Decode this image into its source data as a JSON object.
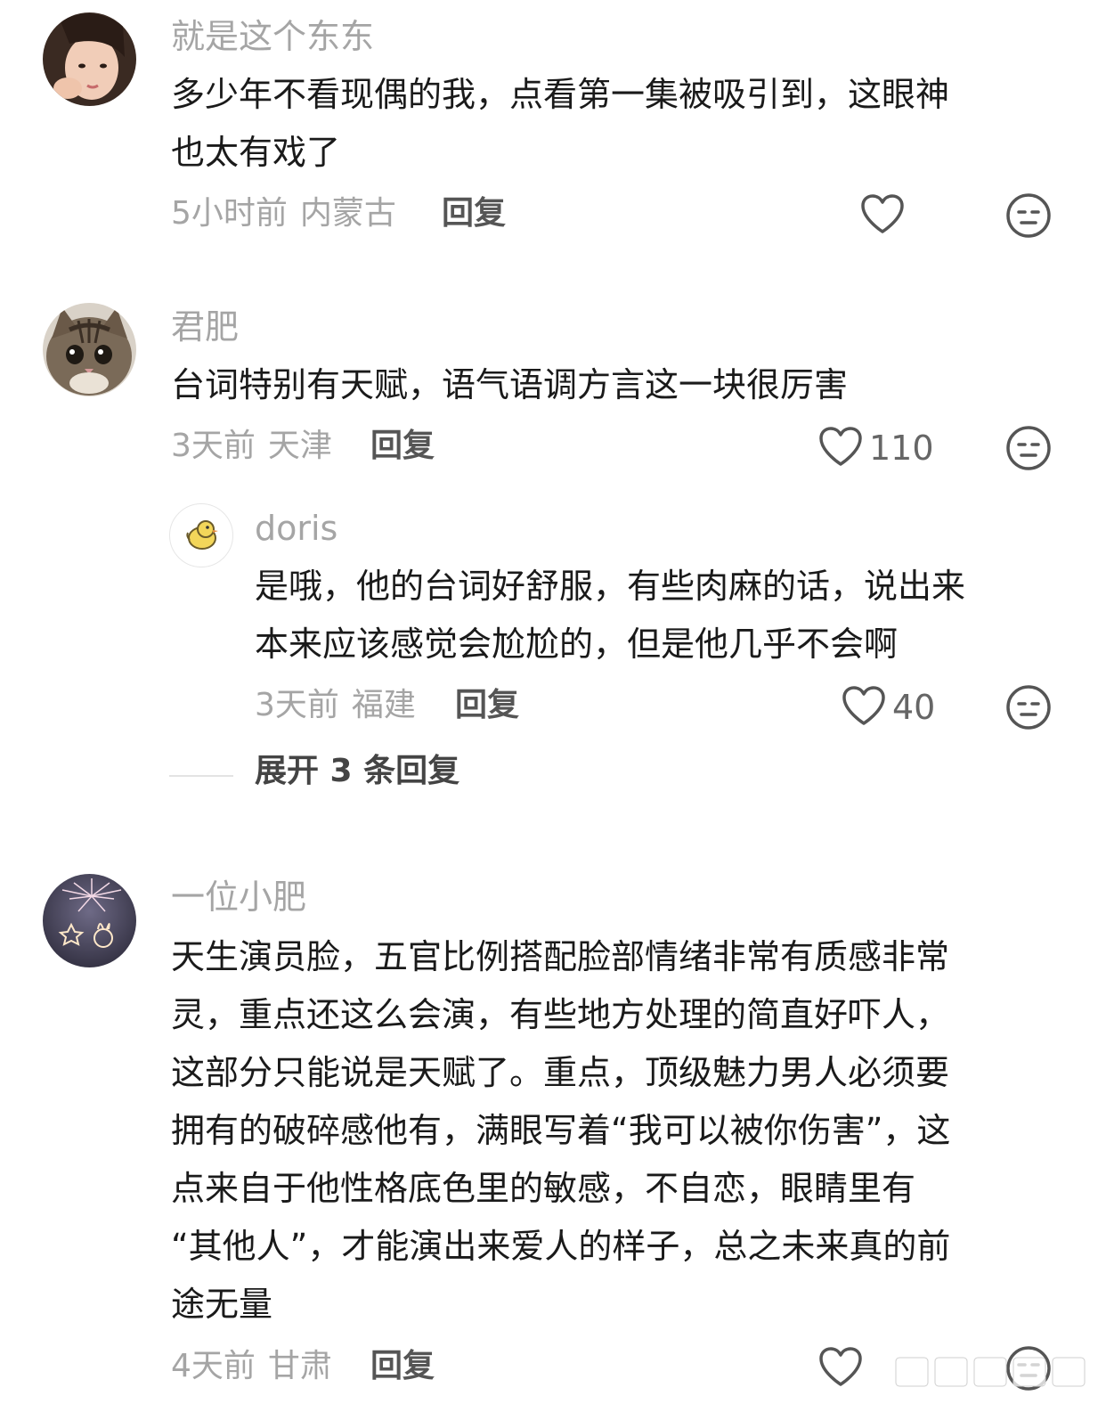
{
  "comments": [
    {
      "username": "就是这个东东",
      "text_lines": [
        "多少年不看现偶的我，点看第一集被吸引到，这眼神",
        "也太有戏了"
      ],
      "time": "5小时前",
      "location": "内蒙古",
      "reply_label": "回复",
      "like_count": ""
    },
    {
      "username": "君肥",
      "text_lines": [
        "台词特别有天赋，语气语调方言这一块很厉害"
      ],
      "time": "3天前",
      "location": "天津",
      "reply_label": "回复",
      "like_count": "110",
      "replies": [
        {
          "username": "doris",
          "text_lines": [
            "是哦，他的台词好舒服，有些肉麻的话，说出来",
            "本来应该感觉会尬尬的，但是他几乎不会啊"
          ],
          "time": "3天前",
          "location": "福建",
          "reply_label": "回复",
          "like_count": "40"
        }
      ],
      "expand_label": "展开 3 条回复"
    },
    {
      "username": "一位小肥",
      "text_lines": [
        "天生演员脸，五官比例搭配脸部情绪非常有质感非常",
        "灵，重点还这么会演，有些地方处理的简直好吓人，",
        "这部分只能说是天赋了。重点，顶级魅力男人必须要",
        "拥有的破碎感他有，满眼写着“我可以被你伤害”，这",
        "点来自于他性格底色里的敏感，不自恋，眼睛里有",
        "“其他人”，才能演出来爱人的样子，总之未来真的前",
        "途无量"
      ],
      "time": "4天前",
      "location": "甘肃",
      "reply_label": "回复",
      "like_count": ""
    }
  ],
  "icons": {
    "like": "heart-outline-icon",
    "dislike": "neutral-face-icon"
  },
  "colors": {
    "username": "#a5a5a5",
    "text": "#1a1a1a",
    "meta": "#a5a5a5",
    "reply": "#555555"
  }
}
